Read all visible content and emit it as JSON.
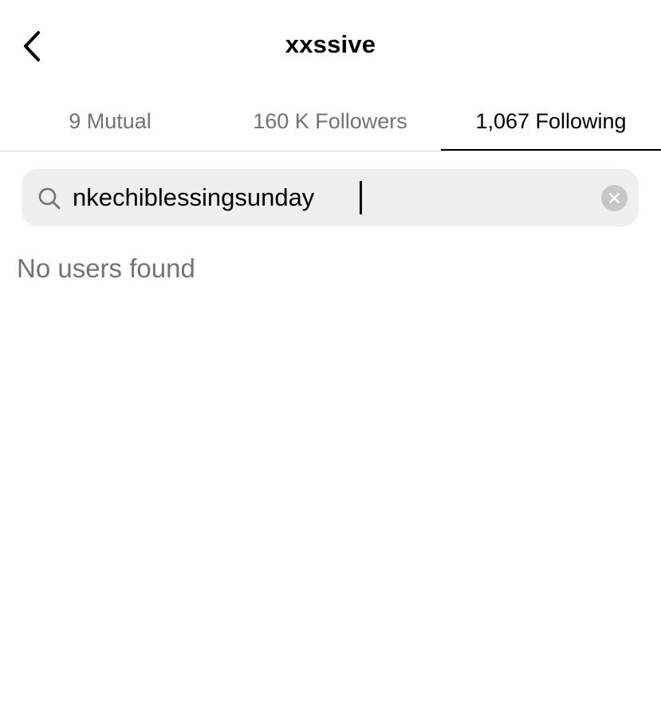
{
  "header": {
    "back_icon": "chevron-left-icon",
    "title": "xxssive"
  },
  "tabs": [
    {
      "label": "9 Mutual",
      "active": false
    },
    {
      "label": "160 K Followers",
      "active": false
    },
    {
      "label": "1,067 Following",
      "active": true
    }
  ],
  "search": {
    "icon": "search-icon",
    "value": "nkechiblessingsunday",
    "clear_icon": "clear-icon"
  },
  "results": {
    "empty_message": "No users found"
  },
  "colors": {
    "active_tab": "#000000",
    "inactive_tab": "#737373",
    "search_background": "#efefef",
    "clear_button": "#c7c7c7"
  }
}
